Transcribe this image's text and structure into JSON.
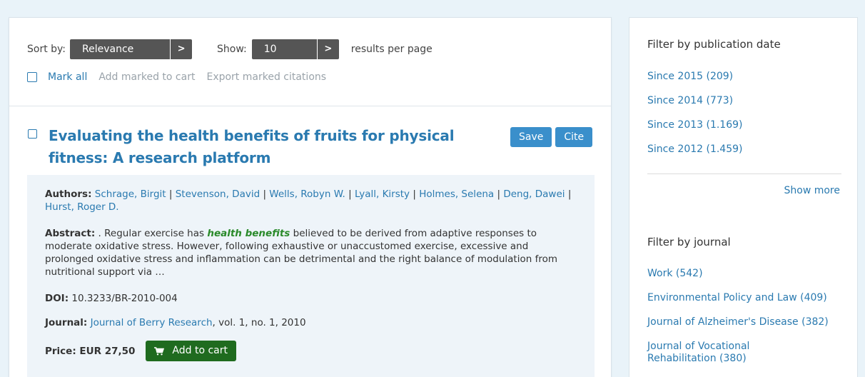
{
  "toolbar": {
    "sort_label": "Sort by:",
    "sort_value": "Relevance",
    "sort_btn": ">",
    "show_label": "Show:",
    "show_value": "10",
    "show_btn": ">",
    "per_page_label": "results per page",
    "mark_all": "Mark all",
    "add_marked": "Add marked to cart",
    "export_marked": "Export marked citations"
  },
  "result": {
    "title": "Evaluating the health benefits of fruits for physical fitness: A research platform",
    "save_label": "Save",
    "cite_label": "Cite",
    "authors_label": "Authors:",
    "authors": [
      "Schrage, Birgit",
      "Stevenson, David",
      "Wells, Robyn W.",
      "Lyall, Kirsty",
      "Holmes, Selena",
      "Deng, Dawei",
      "Hurst, Roger D."
    ],
    "author_separator": " | ",
    "abstract_label": "Abstract:",
    "abstract_before": " . Regular exercise has ",
    "abstract_highlight": "health benefits",
    "abstract_after": " believed to be derived from adaptive responses to moderate oxidative stress. However, following exhaustive or unaccustomed exercise, excessive and prolonged oxidative stress and inflammation can be detrimental and the right balance of modulation from nutritional support via …",
    "doi_label": "DOI:",
    "doi": " 10.3233/BR-2010-004",
    "journal_label": "Journal:",
    "journal_name": "Journal of Berry Research",
    "journal_details": ", vol. 1, no. 1, 2010",
    "price_label": "Price: EUR 27,50",
    "add_to_cart": "Add to cart"
  },
  "filters": {
    "date_heading": "Filter by publication date",
    "date_items": [
      "Since 2015 (209)",
      "Since 2014 (773)",
      "Since 2013 (1.169)",
      "Since 2012 (1.459)"
    ],
    "show_more": "Show more",
    "journal_heading": "Filter by journal",
    "journal_items": [
      "Work (542)",
      "Environmental Policy and Law (409)",
      "Journal of Alzheimer's Disease (382)",
      "Journal of Vocational Rehabilitation (380)"
    ]
  },
  "colors": {
    "link": "#2a7ab0",
    "select_bg": "#555555",
    "cart_button": "#1f6b1f",
    "save_cite_button": "#3a8fcb",
    "highlight": "#2a8a2a",
    "detail_bg": "#eef4f9",
    "page_bg": "#e9f3f9"
  },
  "icons": {
    "cart": "shopping-cart-icon",
    "select_arrow": "chevron-right-icon"
  }
}
